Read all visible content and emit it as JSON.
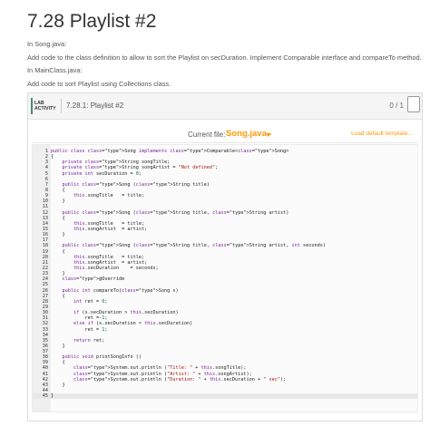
{
  "page": {
    "title": "7.28 Playlist #2",
    "instructions": [
      "In Song.java:",
      "Add code to the class definition to allow to sort the Playlist on secDuration. Implement Comparable interface and compareTo method.",
      "In MainClass.java:",
      "Add code to sort Playlist using Collections class."
    ]
  },
  "lab": {
    "badge_line1": "LAB",
    "badge_line2": "ACTIVITY",
    "title": "7.28.1: Playlist #2",
    "score": "0 / 1",
    "current_file_label": "Current file:",
    "current_file": "Song.java",
    "load_template": "Load default template..."
  },
  "code": [
    "public class Song implements Comparable<Song>",
    "{",
    "    private String songTitle;",
    "    private String songArtist = \"Not defined\";",
    "    private int secDuration = 0;",
    "",
    "    public Song (String title)",
    "    {",
    "        this.songTitle   = title;",
    "    }",
    "",
    "    public Song (String title, String artist)",
    "    {",
    "        this.songTitle   = title;",
    "        this.songArtist  = artist;",
    "    }",
    "",
    "    public Song (String title, String artist, int seconds)",
    "    {",
    "        this.songTitle   = title;",
    "        this.songArtist  = artist;",
    "        this.secDuration    = seconds;",
    "    }",
    "    @Override",
    "",
    "    public int compareTo(Song s)",
    "    {",
    "        int ret = 0;",
    "",
    "        if (s.secDuration > this.secDuration)",
    "            ret =-1;",
    "        else if (s.secDuration < this.secDuration)",
    "            ret = 1;",
    "",
    "        return ret;",
    "    }",
    "",
    "    public void printSongInfo ()",
    "    {",
    "        System.out.println (\"Title: \" + this.songTitle);",
    "        System.out.println (\"Artist: \" + this.songArtist);",
    "        System.out.println (\"Duration: \" + this.secDuration + \" sec\");",
    "    }",
    "",
    "}"
  ],
  "active_line": 45,
  "colors": {
    "accent": "#ff9800",
    "lab_badge_border": "#4a8a6f"
  }
}
